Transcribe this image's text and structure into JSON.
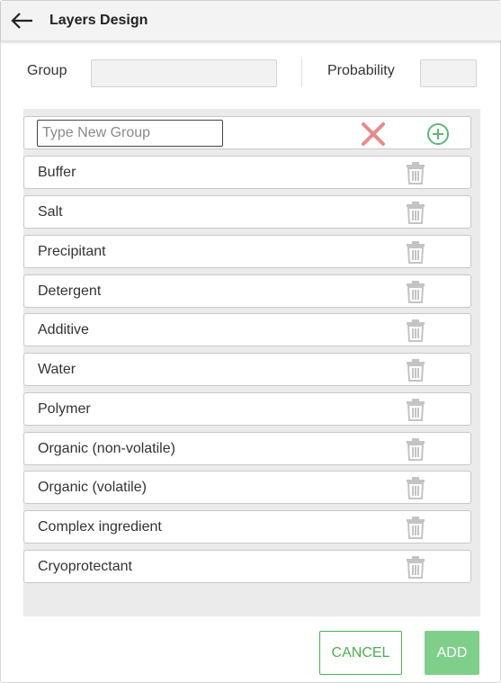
{
  "header": {
    "title": "Layers Design"
  },
  "form": {
    "group_label": "Group",
    "group_value": "",
    "probability_label": "Probability",
    "probability_value": ""
  },
  "new_group": {
    "placeholder": "Type New Group",
    "value": ""
  },
  "groups": [
    {
      "label": "Buffer"
    },
    {
      "label": "Salt"
    },
    {
      "label": "Precipitant"
    },
    {
      "label": "Detergent"
    },
    {
      "label": "Additive"
    },
    {
      "label": "Water"
    },
    {
      "label": "Polymer"
    },
    {
      "label": "Organic (non-volatile)"
    },
    {
      "label": "Organic (volatile)"
    },
    {
      "label": "Complex ingredient"
    },
    {
      "label": "Cryoprotectant"
    }
  ],
  "actions": {
    "cancel_label": "CANCEL",
    "add_label": "ADD"
  },
  "icons": {
    "back": "arrow-left-icon",
    "remove": "close-icon",
    "add": "plus-circle-icon",
    "delete": "trash-icon"
  },
  "colors": {
    "accent": "#4caf50",
    "add_disabled": "#7fcf8a",
    "remove": "#e98a8a",
    "trash": "#c4c4c4",
    "panel": "#ebebeb"
  }
}
